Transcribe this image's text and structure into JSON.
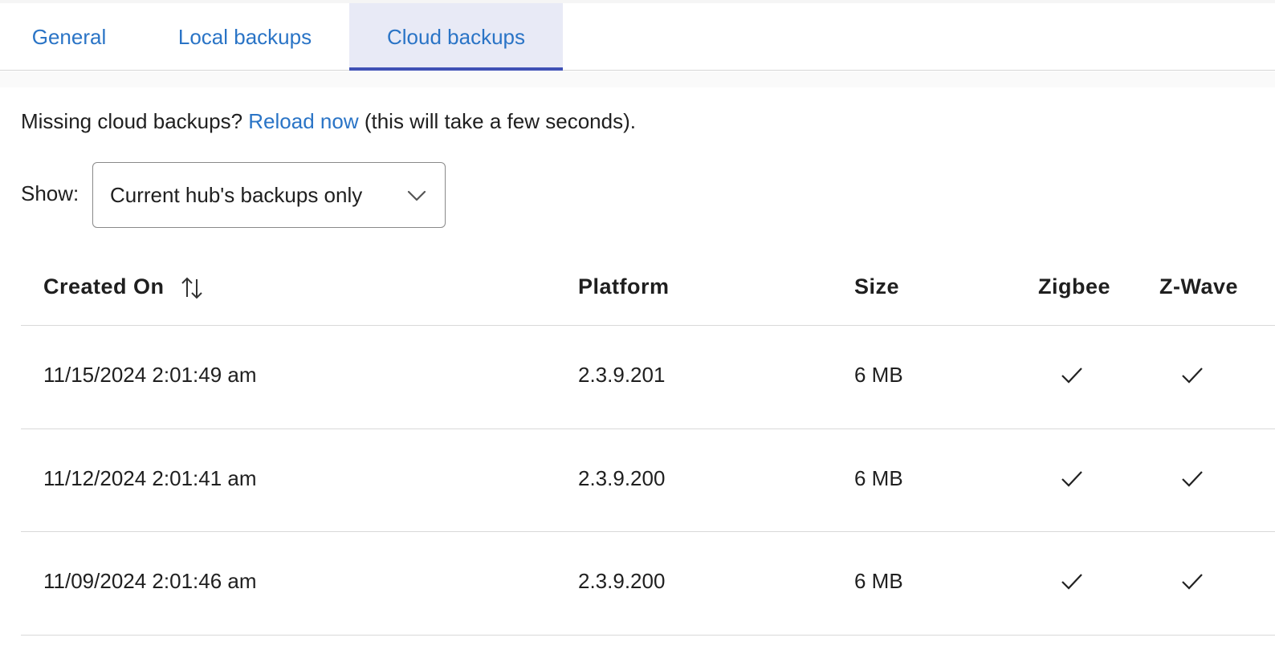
{
  "tabs": [
    {
      "label": "General",
      "active": false
    },
    {
      "label": "Local backups",
      "active": false
    },
    {
      "label": "Cloud backups",
      "active": true
    }
  ],
  "notice": {
    "prefix": "Missing cloud backups?",
    "link": "Reload now",
    "suffix": "(this will take a few seconds)."
  },
  "filter": {
    "label": "Show:",
    "selected": "Current hub's backups only"
  },
  "table": {
    "headers": [
      "Created On",
      "Platform",
      "Size",
      "Zigbee",
      "Z-Wave"
    ],
    "sort_icon": "sort-arrows-icon",
    "rows": [
      {
        "created": "11/15/2024 2:01:49 am",
        "platform": "2.3.9.201",
        "size": "6 MB",
        "zigbee": true,
        "zwave": true
      },
      {
        "created": "11/12/2024 2:01:41 am",
        "platform": "2.3.9.200",
        "size": "6 MB",
        "zigbee": true,
        "zwave": true
      },
      {
        "created": "11/09/2024 2:01:46 am",
        "platform": "2.3.9.200",
        "size": "6 MB",
        "zigbee": true,
        "zwave": true
      }
    ]
  },
  "colors": {
    "accent": "#2a74c6",
    "active_tab_bg": "#e8eaf6",
    "active_tab_indicator": "#3f51b5"
  }
}
